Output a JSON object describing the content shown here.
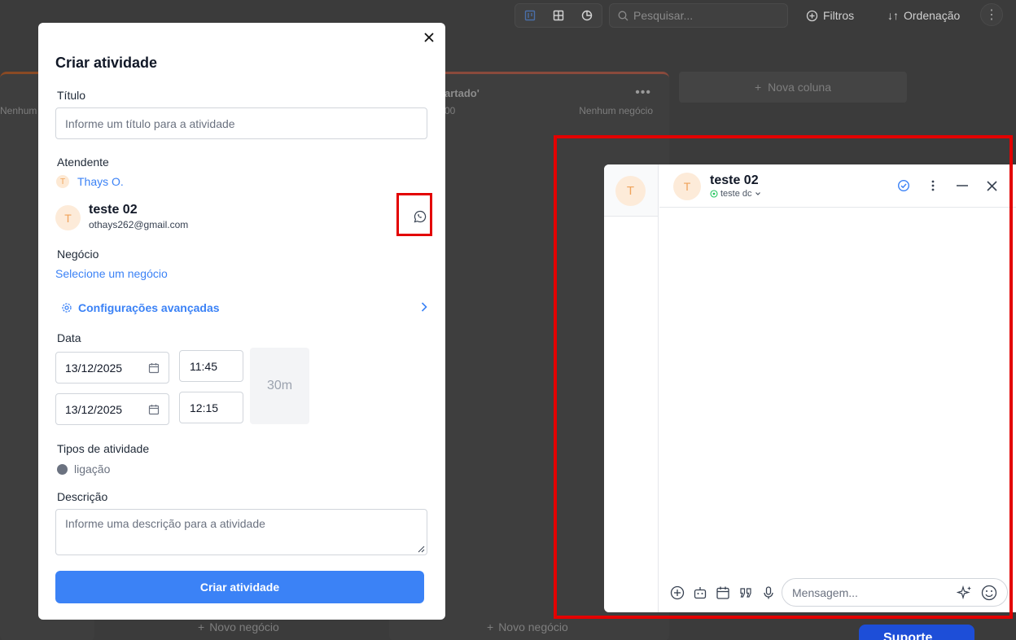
{
  "toolbar": {
    "search_placeholder": "Pesquisar...",
    "filters_label": "Filtros",
    "order_label": "Ordenação"
  },
  "board": {
    "col1_empty": "Nenhum",
    "col2_title": "artado'",
    "col2_value": "00",
    "col2_empty": "Nenhum negócio",
    "new_column": "Nova coluna",
    "new_deal": "Novo negócio",
    "support": "Suporte"
  },
  "modal": {
    "title": "Criar atividade",
    "title_label": "Título",
    "title_placeholder": "Informe um título para a atividade",
    "attendant_label": "Atendente",
    "attendant_initial": "T",
    "attendant_name": "Thays O.",
    "contact_initial": "T",
    "contact_name": "teste 02",
    "contact_email": "othays262@gmail.com",
    "deal_label": "Negócio",
    "deal_link": "Selecione um negócio",
    "advanced": "Configurações avançadas",
    "date_label": "Data",
    "start_date": "13/12/2025",
    "start_time": "11:45",
    "end_date": "13/12/2025",
    "end_time": "12:15",
    "duration": "30m",
    "types_label": "Tipos de atividade",
    "type_value": "ligação",
    "description_label": "Descrição",
    "description_placeholder": "Informe uma descrição para a atividade",
    "submit": "Criar atividade"
  },
  "chat": {
    "side_initial": "T",
    "initial": "T",
    "name": "teste 02",
    "channel": "teste dc",
    "message_placeholder": "Mensagem..."
  },
  "colors": {
    "accent": "#3b82f6",
    "highlight": "#e30000",
    "whatsapp": "#22c55e",
    "avatar_bg": "#fdebd9",
    "avatar_fg": "#f0a35a"
  }
}
